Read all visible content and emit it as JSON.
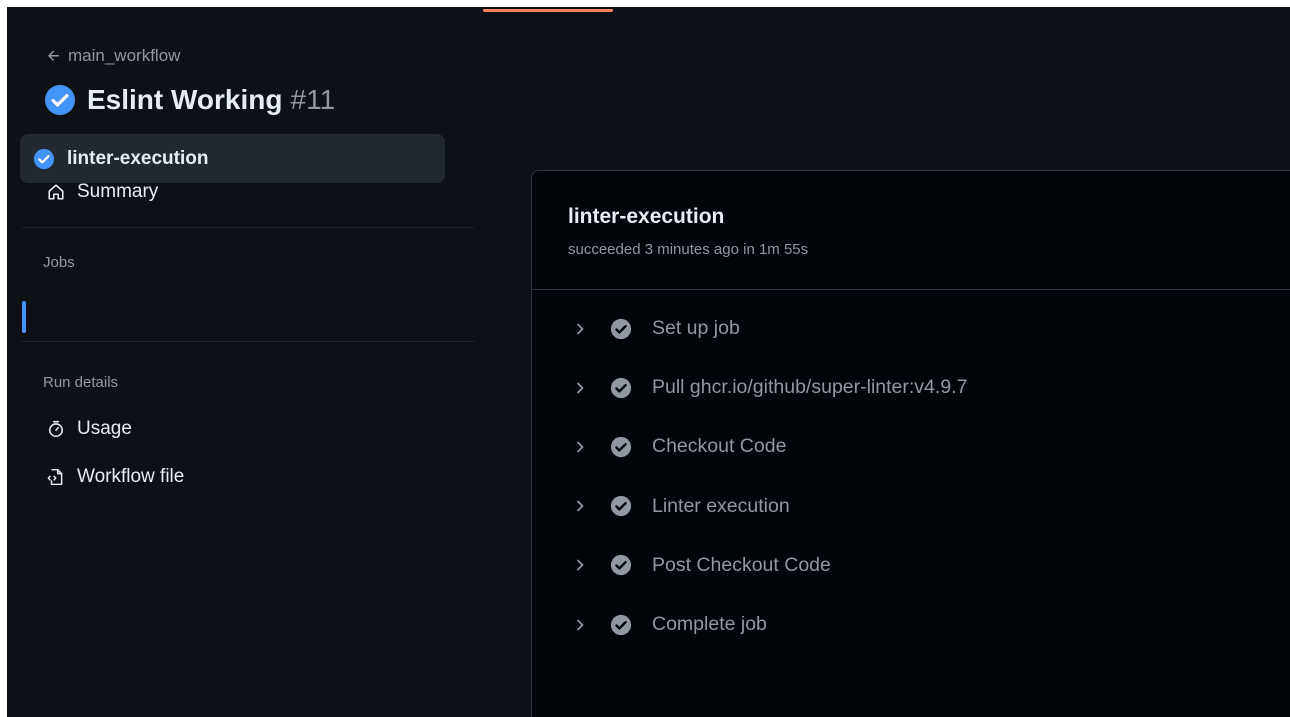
{
  "header": {
    "back_label": "main_workflow",
    "run_title": "Eslint Working",
    "run_number": "#11"
  },
  "sidebar": {
    "summary_label": "Summary",
    "jobs_heading": "Jobs",
    "jobs": [
      {
        "label": "linter-execution",
        "status": "success",
        "active": true
      }
    ],
    "run_details_heading": "Run details",
    "details": [
      {
        "label": "Usage",
        "icon": "stopwatch-icon"
      },
      {
        "label": "Workflow file",
        "icon": "file-code-icon"
      }
    ]
  },
  "job": {
    "title": "linter-execution",
    "subtitle": "succeeded 3 minutes ago in 1m 55s",
    "steps": [
      {
        "label": "Set up job"
      },
      {
        "label": "Pull ghcr.io/github/super-linter:v4.9.7"
      },
      {
        "label": "Checkout Code"
      },
      {
        "label": "Linter execution"
      },
      {
        "label": "Post Checkout Code"
      },
      {
        "label": "Complete job"
      }
    ]
  },
  "colors": {
    "background": "#0d1117",
    "panel": "#010409",
    "accent_blue": "#4493f8",
    "muted_text": "#9198a1",
    "top_accent": "#f78166"
  }
}
